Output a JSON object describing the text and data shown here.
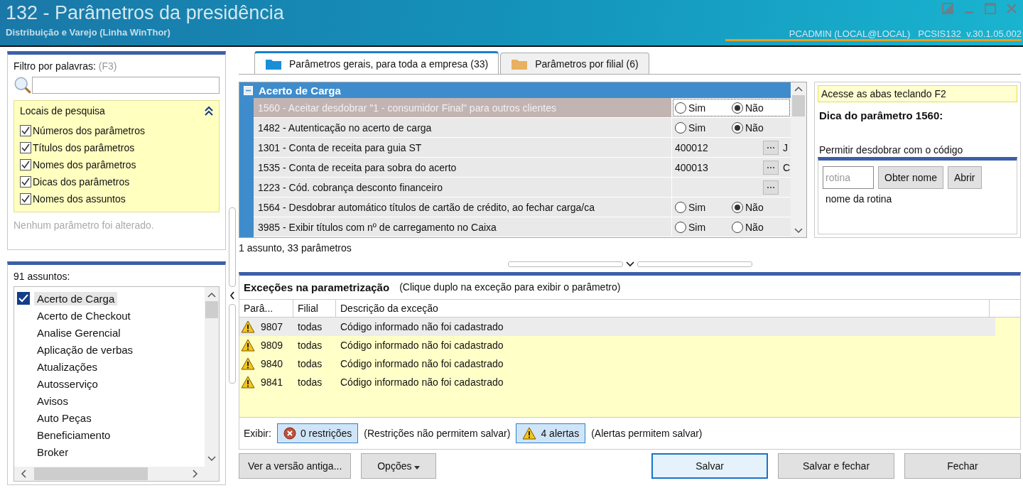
{
  "window": {
    "title": "132 - Parâmetros da presidência",
    "subtitle": "Distribuição e Varejo (Linha WinThor)",
    "user_info": "PCADMIN (LOCAL@LOCAL)   PCSIS132  v.30.1.05.002"
  },
  "filter": {
    "label": "Filtro por palavras:",
    "shortcut": "(F3)",
    "search_locations": {
      "title": "Locais de pesquisa",
      "expanded": true,
      "options": [
        {
          "label": "Números dos parâmetros",
          "checked": true
        },
        {
          "label": "Títulos dos parâmetros",
          "checked": true
        },
        {
          "label": "Nomes dos parâmetros",
          "checked": true
        },
        {
          "label": "Dicas dos parâmetros",
          "checked": true
        },
        {
          "label": "Nomes dos assuntos",
          "checked": true
        }
      ]
    },
    "status": "Nenhum parâmetro foi alterado."
  },
  "subjects": {
    "count_label": "91 assuntos:",
    "items": [
      {
        "label": "Acerto de Carga",
        "selected": true
      },
      {
        "label": "Acerto de Checkout",
        "selected": false
      },
      {
        "label": "Analise Gerencial",
        "selected": false
      },
      {
        "label": "Aplicação de verbas",
        "selected": false
      },
      {
        "label": "Atualizações",
        "selected": false
      },
      {
        "label": "Autosserviço",
        "selected": false
      },
      {
        "label": "Avisos",
        "selected": false
      },
      {
        "label": "Auto Peças",
        "selected": false
      },
      {
        "label": "Beneficiamento",
        "selected": false
      },
      {
        "label": "Broker",
        "selected": false
      }
    ]
  },
  "tabs": [
    {
      "label": "Parâmetros gerais, para toda a empresa  (33)",
      "selected": true
    },
    {
      "label": "Parâmetros por filial  (6)",
      "selected": false
    }
  ],
  "parameters": {
    "group": {
      "title": "Acerto de Carga",
      "expanded": true
    },
    "rows": [
      {
        "kind": "radio",
        "label": "1560 - Aceitar desdobrar \"1 - consumidor Final\" para outros clientes",
        "selected": true,
        "options": [
          {
            "label": "Sim",
            "selected": false
          },
          {
            "label": "Não",
            "selected": true
          }
        ]
      },
      {
        "kind": "radio",
        "label": "1482 - Autenticação no acerto de carga",
        "selected": false,
        "options": [
          {
            "label": "Sim",
            "selected": false
          },
          {
            "label": "Não",
            "selected": true
          }
        ]
      },
      {
        "kind": "lookup",
        "label": "1301 - Conta de receita para guia ST",
        "selected": false,
        "value": "400012",
        "extra": "J"
      },
      {
        "kind": "lookup",
        "label": "1535 - Conta de receita para sobra do acerto",
        "selected": false,
        "value": "400013",
        "extra": "C"
      },
      {
        "kind": "lookup",
        "label": "1223 - Cód. cobrança desconto financeiro",
        "selected": false
      },
      {
        "kind": "radio",
        "label": "1564 - Desdobrar automático títulos de cartão de crédito, ao fechar carga/ca",
        "selected": false,
        "options": [
          {
            "label": "Sim",
            "selected": false
          },
          {
            "label": "Não",
            "selected": true
          }
        ]
      },
      {
        "kind": "radio",
        "label": "3985 - Exibir títulos com nº de carregamento no Caixa",
        "selected": false,
        "options": [
          {
            "label": "Sim",
            "selected": false
          },
          {
            "label": "Não",
            "selected": false
          }
        ]
      }
    ],
    "summary": "1 assunto, 33 parâmetros"
  },
  "hint": {
    "tip": "Acesse as abas teclando F2",
    "title": "Dica do parâmetro 1560:",
    "text": "Permitir desdobrar com o código",
    "routine": {
      "placeholder": "rotina",
      "buttons": [
        "Obter nome",
        "Abrir"
      ],
      "name_label": "nome da rotina"
    }
  },
  "exceptions": {
    "title": "Exceções na parametrização",
    "subtitle": "(Clique duplo na exceção para exibir o parâmetro)",
    "columns": [
      "Parâ...",
      "Filial",
      "Descrição da exceção"
    ],
    "rows": [
      {
        "param": "9807",
        "branch": "todas",
        "description": "Código informado não foi cadastrado",
        "selected": true
      },
      {
        "param": "9809",
        "branch": "todas",
        "description": "Código informado não foi cadastrado",
        "selected": false
      },
      {
        "param": "9840",
        "branch": "todas",
        "description": "Código informado não foi cadastrado",
        "selected": false
      },
      {
        "param": "9841",
        "branch": "todas",
        "description": "Código informado não foi cadastrado",
        "selected": false
      }
    ],
    "show_label": "Exibir:",
    "filters": [
      {
        "kind": "restriction",
        "label": "0 restrições",
        "note": "(Restrições não permitem salvar)"
      },
      {
        "kind": "alert",
        "label": "4 alertas",
        "note": "(Alertas permitem salvar)"
      }
    ]
  },
  "buttons": {
    "left": [
      {
        "label": "Ver a versão antiga...",
        "kind": "plain"
      },
      {
        "label": "Opções",
        "kind": "dropdown"
      }
    ],
    "right": [
      {
        "label": "Salvar",
        "focused": true
      },
      {
        "label": "Salvar e fechar",
        "focused": false
      },
      {
        "label": "Fechar",
        "focused": false
      }
    ]
  }
}
